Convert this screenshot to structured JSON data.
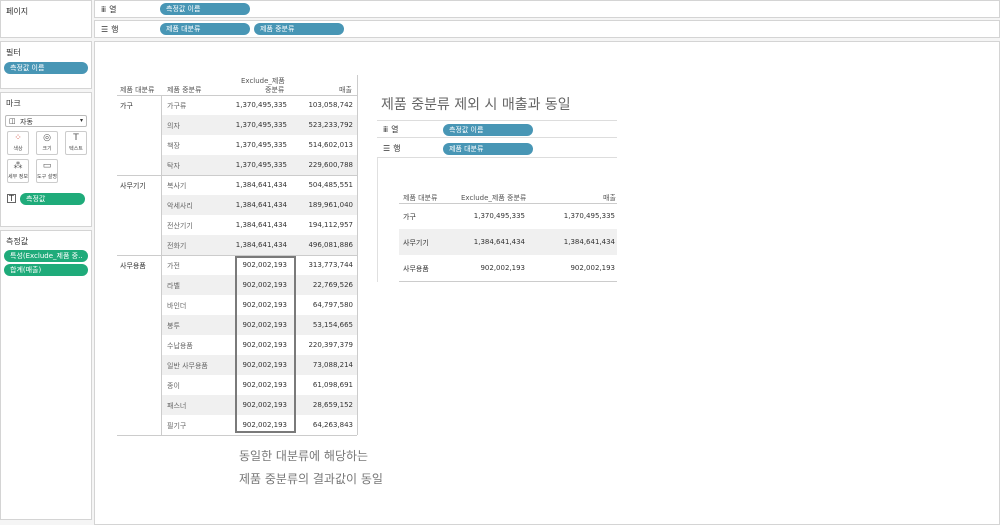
{
  "left": {
    "pages_title": "페이지",
    "filters_title": "필터",
    "filter_pill": "측정값 이름",
    "marks_title": "마크",
    "marks_dropdown": "자동",
    "mark_buttons": [
      {
        "label": "색상",
        "icon": "color-icon"
      },
      {
        "label": "크기",
        "icon": "size-icon"
      },
      {
        "label": "텍스트",
        "icon": "text-icon"
      },
      {
        "label": "세부 정보",
        "icon": "detail-icon"
      },
      {
        "label": "도구 설명",
        "icon": "tooltip-icon"
      }
    ],
    "marks_pill": "측정값",
    "measures_title": "측정값",
    "measure_pills": [
      "특성(Exclude_제품 중..",
      "합계(매출)"
    ]
  },
  "shelves": {
    "columns_label": "열",
    "columns_pills": [
      "측정값 이름"
    ],
    "rows_label": "행",
    "rows_pills": [
      "제품 대분류",
      "제품 중분류"
    ]
  },
  "table": {
    "headers": [
      "제품 대분류",
      "제품 중분류",
      "Exclude_제품\n중분류",
      "매출"
    ],
    "header_exclude_line1": "Exclude_제품",
    "header_exclude_line2": "중분류",
    "groups": [
      {
        "category": "가구",
        "rows": [
          {
            "sub": "가구류",
            "exclude": "1,370,495,335",
            "sales": "103,058,742"
          },
          {
            "sub": "의자",
            "exclude": "1,370,495,335",
            "sales": "523,233,792"
          },
          {
            "sub": "책장",
            "exclude": "1,370,495,335",
            "sales": "514,602,013"
          },
          {
            "sub": "탁자",
            "exclude": "1,370,495,335",
            "sales": "229,600,788"
          }
        ]
      },
      {
        "category": "사무기기",
        "rows": [
          {
            "sub": "복사기",
            "exclude": "1,384,641,434",
            "sales": "504,485,551"
          },
          {
            "sub": "악세사리",
            "exclude": "1,384,641,434",
            "sales": "189,961,040"
          },
          {
            "sub": "전산기기",
            "exclude": "1,384,641,434",
            "sales": "194,112,957"
          },
          {
            "sub": "전화기",
            "exclude": "1,384,641,434",
            "sales": "496,081,886"
          }
        ]
      },
      {
        "category": "사무용품",
        "rows": [
          {
            "sub": "가전",
            "exclude": "902,002,193",
            "sales": "313,773,744"
          },
          {
            "sub": "라벨",
            "exclude": "902,002,193",
            "sales": "22,769,526"
          },
          {
            "sub": "바인더",
            "exclude": "902,002,193",
            "sales": "64,797,580"
          },
          {
            "sub": "봉투",
            "exclude": "902,002,193",
            "sales": "53,154,665"
          },
          {
            "sub": "수납용품",
            "exclude": "902,002,193",
            "sales": "220,397,379"
          },
          {
            "sub": "일반 사무용품",
            "exclude": "902,002,193",
            "sales": "73,088,214"
          },
          {
            "sub": "종이",
            "exclude": "902,002,193",
            "sales": "61,098,691"
          },
          {
            "sub": "패스너",
            "exclude": "902,002,193",
            "sales": "28,659,152"
          },
          {
            "sub": "필기구",
            "exclude": "902,002,193",
            "sales": "64,263,843"
          }
        ]
      }
    ]
  },
  "annotation": {
    "line1": "동일한 대분류에 해당하는",
    "line2": "제품 중분류의 결과값이 동일"
  },
  "inset": {
    "title": "제품 중분류 제외 시 매출과 동일",
    "columns_label": "열",
    "columns_pill": "측정값 이름",
    "rows_label": "행",
    "rows_pill": "제품 대분류",
    "headers": [
      "제품 대분류",
      "Exclude_제품 중분류",
      "매출"
    ],
    "rows": [
      {
        "category": "가구",
        "exclude": "1,370,495,335",
        "sales": "1,370,495,335"
      },
      {
        "category": "사무기기",
        "exclude": "1,384,641,434",
        "sales": "1,384,641,434"
      },
      {
        "category": "사무용품",
        "exclude": "902,002,193",
        "sales": "902,002,193"
      }
    ]
  }
}
